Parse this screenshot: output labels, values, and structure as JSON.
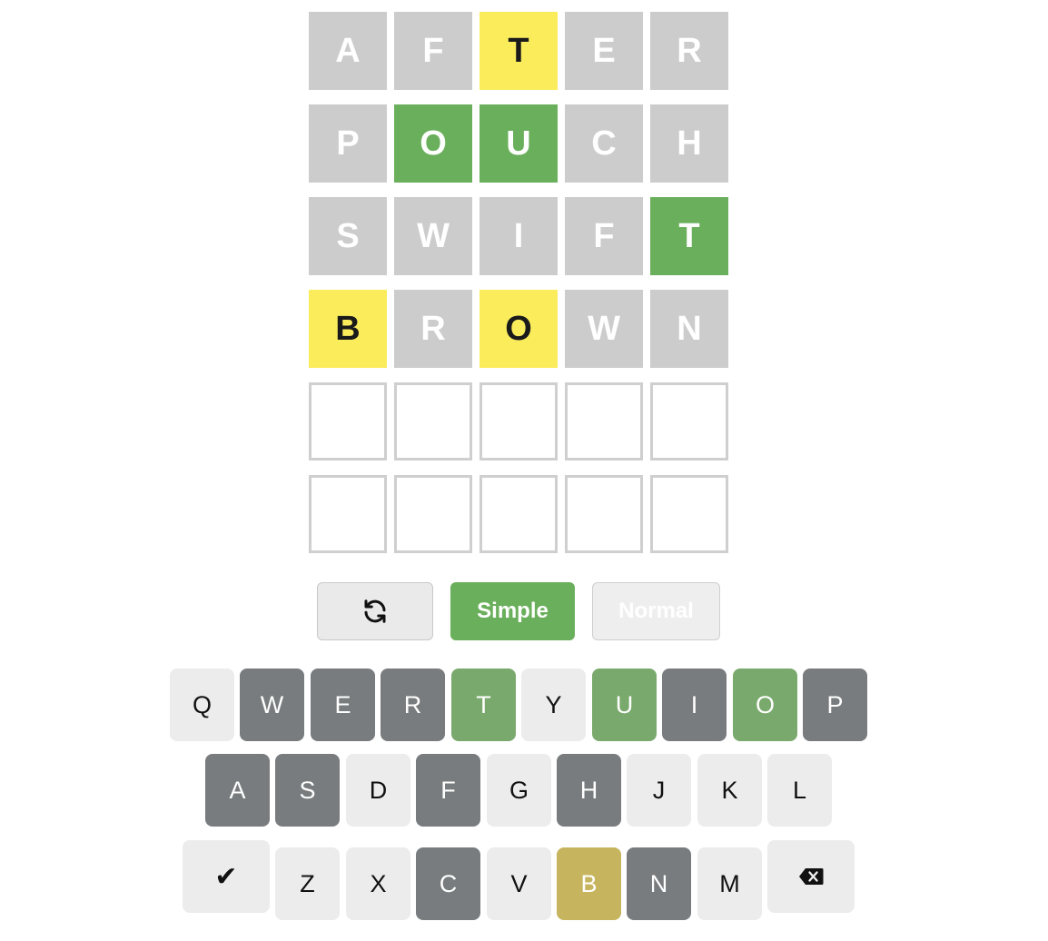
{
  "board": {
    "rows": [
      [
        {
          "letter": "A",
          "state": "absent"
        },
        {
          "letter": "F",
          "state": "absent"
        },
        {
          "letter": "T",
          "state": "present"
        },
        {
          "letter": "E",
          "state": "absent"
        },
        {
          "letter": "R",
          "state": "absent"
        }
      ],
      [
        {
          "letter": "P",
          "state": "absent"
        },
        {
          "letter": "O",
          "state": "correct"
        },
        {
          "letter": "U",
          "state": "correct"
        },
        {
          "letter": "C",
          "state": "absent"
        },
        {
          "letter": "H",
          "state": "absent"
        }
      ],
      [
        {
          "letter": "S",
          "state": "absent"
        },
        {
          "letter": "W",
          "state": "absent"
        },
        {
          "letter": "I",
          "state": "absent"
        },
        {
          "letter": "F",
          "state": "absent"
        },
        {
          "letter": "T",
          "state": "correct"
        }
      ],
      [
        {
          "letter": "B",
          "state": "present"
        },
        {
          "letter": "R",
          "state": "absent"
        },
        {
          "letter": "O",
          "state": "present"
        },
        {
          "letter": "W",
          "state": "absent"
        },
        {
          "letter": "N",
          "state": "absent"
        }
      ],
      [
        {
          "letter": "",
          "state": "empty"
        },
        {
          "letter": "",
          "state": "empty"
        },
        {
          "letter": "",
          "state": "empty"
        },
        {
          "letter": "",
          "state": "empty"
        },
        {
          "letter": "",
          "state": "empty"
        }
      ],
      [
        {
          "letter": "",
          "state": "empty"
        },
        {
          "letter": "",
          "state": "empty"
        },
        {
          "letter": "",
          "state": "empty"
        },
        {
          "letter": "",
          "state": "empty"
        },
        {
          "letter": "",
          "state": "empty"
        }
      ]
    ]
  },
  "controls": {
    "reset_icon": "refresh-icon",
    "simple_label": "Simple",
    "normal_label": "Normal"
  },
  "keyboard": {
    "row1": [
      {
        "key": "Q",
        "state": "unused"
      },
      {
        "key": "W",
        "state": "absent"
      },
      {
        "key": "E",
        "state": "absent"
      },
      {
        "key": "R",
        "state": "absent"
      },
      {
        "key": "T",
        "state": "correct"
      },
      {
        "key": "Y",
        "state": "unused"
      },
      {
        "key": "U",
        "state": "correct"
      },
      {
        "key": "I",
        "state": "absent"
      },
      {
        "key": "O",
        "state": "correct"
      },
      {
        "key": "P",
        "state": "absent"
      }
    ],
    "row2": [
      {
        "key": "A",
        "state": "absent"
      },
      {
        "key": "S",
        "state": "absent"
      },
      {
        "key": "D",
        "state": "unused"
      },
      {
        "key": "F",
        "state": "absent"
      },
      {
        "key": "G",
        "state": "unused"
      },
      {
        "key": "H",
        "state": "absent"
      },
      {
        "key": "J",
        "state": "unused"
      },
      {
        "key": "K",
        "state": "unused"
      },
      {
        "key": "L",
        "state": "unused"
      }
    ],
    "row3": [
      {
        "key": "Z",
        "state": "unused"
      },
      {
        "key": "X",
        "state": "unused"
      },
      {
        "key": "C",
        "state": "absent"
      },
      {
        "key": "V",
        "state": "unused"
      },
      {
        "key": "B",
        "state": "present"
      },
      {
        "key": "N",
        "state": "absent"
      },
      {
        "key": "M",
        "state": "unused"
      }
    ],
    "enter_icon": "checkmark-icon",
    "backspace_icon": "backspace-icon"
  },
  "colors": {
    "tile_absent": "#cccccc",
    "tile_present": "#fbec5c",
    "tile_correct": "#6aaf5c",
    "key_absent": "#787c7e",
    "key_correct": "#79a96c",
    "key_present": "#c7b45e",
    "key_unused": "#ececec"
  }
}
